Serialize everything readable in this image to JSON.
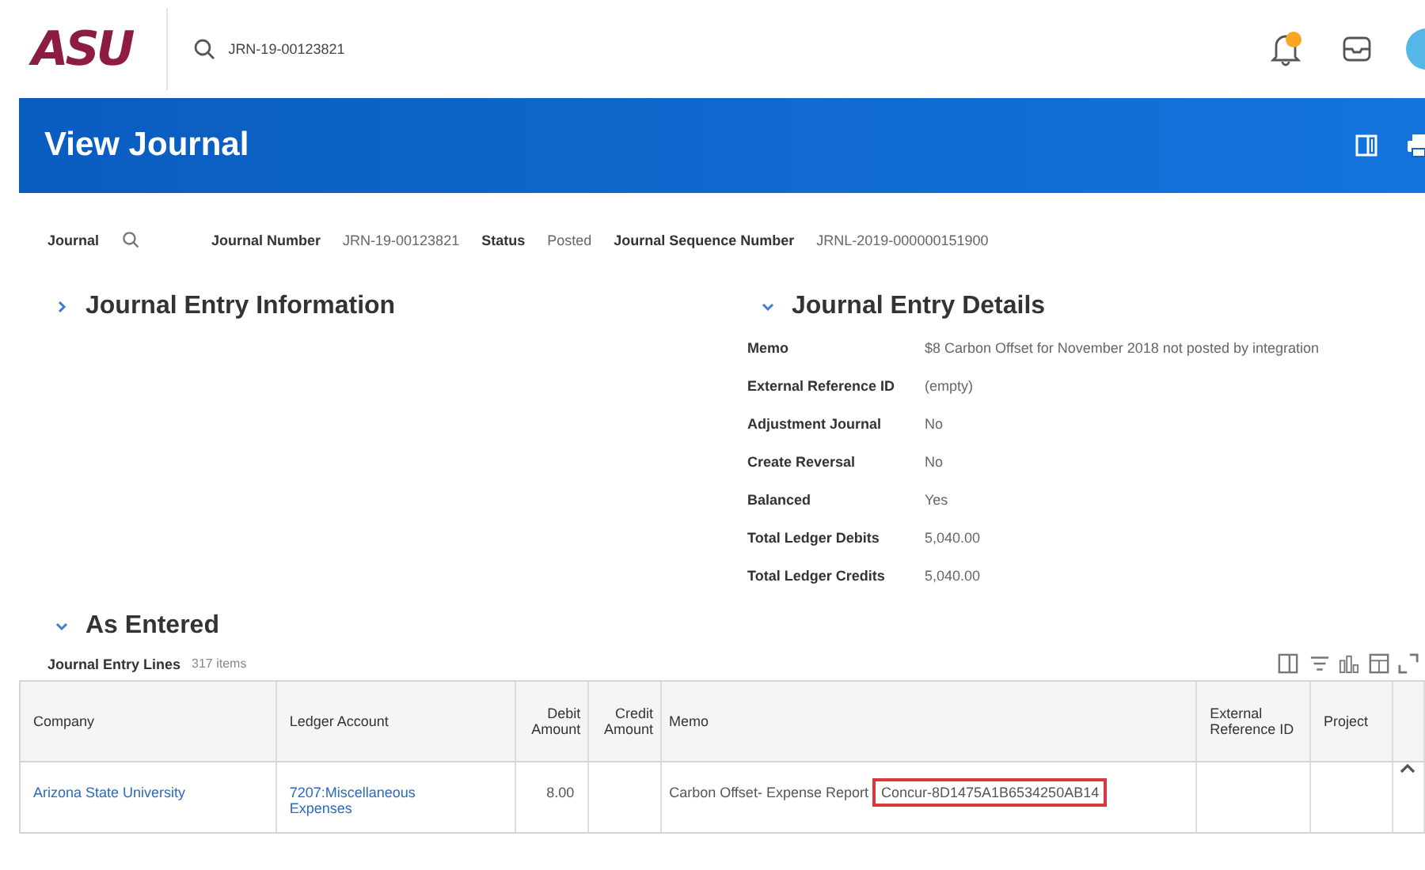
{
  "top_bar": {
    "logo": "ASU",
    "search": {
      "value": "JRN-19-00123821"
    }
  },
  "header": {
    "title": "View Journal"
  },
  "summary": [
    {
      "label": "Journal",
      "kind": "search"
    },
    {
      "label": "Journal Number",
      "value": "JRN-19-00123821",
      "kind": "text"
    },
    {
      "label": "Status",
      "value": "Posted",
      "kind": "text"
    },
    {
      "label": "Journal Sequence Number",
      "value": "JRNL-2019-000000151900",
      "kind": "text"
    }
  ],
  "sections": [
    {
      "title": "Journal Entry Information",
      "expanded": false
    },
    {
      "title": "Journal Entry Details",
      "expanded": true,
      "fields": [
        {
          "label": "Memo",
          "value": "$8 Carbon Offset for November 2018 not posted by integration"
        },
        {
          "label": "External Reference ID",
          "value": "(empty)"
        },
        {
          "label": "Adjustment Journal",
          "value": "No"
        },
        {
          "label": "Create Reversal",
          "value": "No"
        },
        {
          "label": "Balanced",
          "value": "Yes"
        },
        {
          "label": "Total Ledger Debits",
          "value": "5,040.00"
        },
        {
          "label": "Total Ledger Credits",
          "value": "5,040.00"
        }
      ]
    }
  ],
  "as_entered": {
    "title": "As Entered",
    "expanded": true,
    "table_title": "Journal Entry Lines",
    "count": "317 items",
    "columns": [
      "Company",
      "Ledger Account",
      "Debit Amount",
      "Credit Amount",
      "Memo",
      "External Reference ID",
      "Project"
    ],
    "rows": [
      {
        "company": "Arizona State University",
        "ledger_account": "7207:Miscellaneous Expenses",
        "debit": "8.00",
        "credit": "",
        "memo": [
          {
            "text": "Carbon Offset- Expense Report",
            "highlighted": false
          },
          {
            "text": "Concur-8D1475A1B6534250AB14",
            "highlighted": true
          }
        ],
        "external_reference_id": "",
        "project": ""
      }
    ]
  }
}
